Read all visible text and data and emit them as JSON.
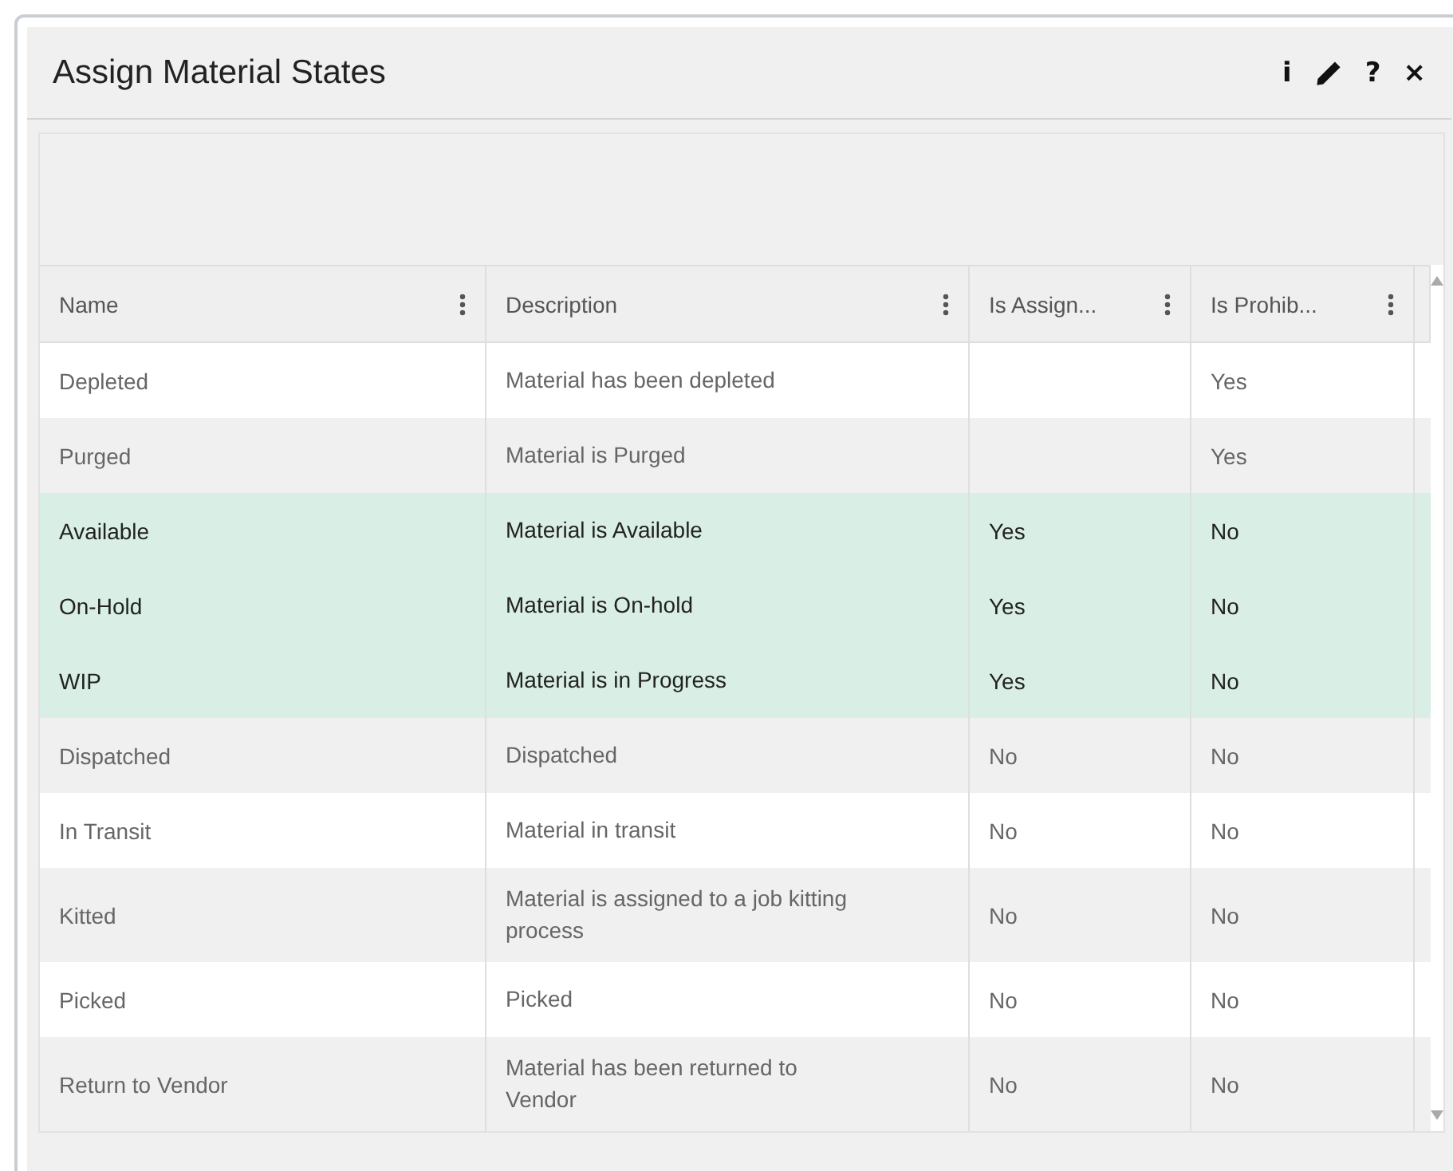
{
  "dialog": {
    "title": "Assign Material States",
    "actions": [
      {
        "kind": "glyph",
        "text": "i"
      },
      {
        "kind": "pencil"
      },
      {
        "kind": "glyph",
        "text": "?"
      },
      {
        "kind": "glyph",
        "text": "×"
      }
    ]
  },
  "table": {
    "columns": [
      "Name",
      "Description",
      "Is Assign...",
      "Is Prohib..."
    ],
    "rows": [
      {
        "name": "Depleted",
        "description": "Material has been depleted",
        "is_assigned": "",
        "is_prohibited": "Yes",
        "selected": false
      },
      {
        "name": "Purged",
        "description": "Material is Purged",
        "is_assigned": "",
        "is_prohibited": "Yes",
        "selected": false
      },
      {
        "name": "Available",
        "description": "Material is Available",
        "is_assigned": "Yes",
        "is_prohibited": "No",
        "selected": true
      },
      {
        "name": "On-Hold",
        "description": "Material is On-hold",
        "is_assigned": "Yes",
        "is_prohibited": "No",
        "selected": true
      },
      {
        "name": "WIP",
        "description": "Material is in Progress",
        "is_assigned": "Yes",
        "is_prohibited": "No",
        "selected": true
      },
      {
        "name": "Dispatched",
        "description": "Dispatched",
        "is_assigned": "No",
        "is_prohibited": "No",
        "selected": false
      },
      {
        "name": "In Transit",
        "description": "Material in transit",
        "is_assigned": "No",
        "is_prohibited": "No",
        "selected": false
      },
      {
        "name": "Kitted",
        "description": "Material is assigned to a job kitting process",
        "is_assigned": "No",
        "is_prohibited": "No",
        "selected": false
      },
      {
        "name": "Picked",
        "description": "Picked",
        "is_assigned": "No",
        "is_prohibited": "No",
        "selected": false
      },
      {
        "name": "Return to Vendor",
        "description": "Material has been returned to Vendor",
        "is_assigned": "No",
        "is_prohibited": "No",
        "selected": false
      }
    ]
  }
}
